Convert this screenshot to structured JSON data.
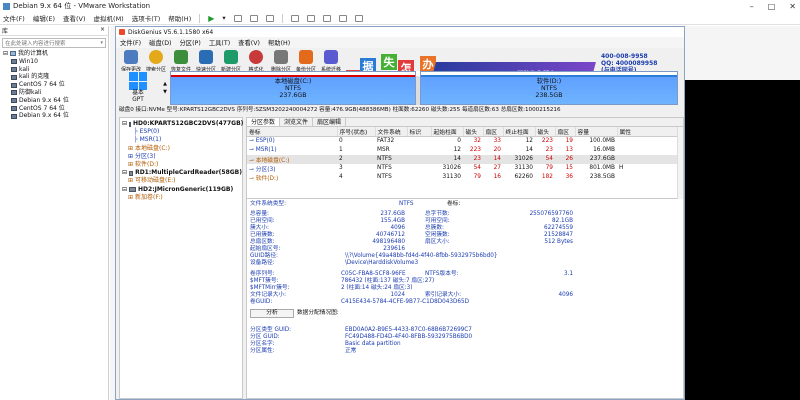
{
  "vmware": {
    "title": "Debian 9.x 64 位 - VMware Workstation",
    "menu": [
      "文件(F)",
      "编辑(E)",
      "查看(V)",
      "虚拟机(M)",
      "选项卡(T)",
      "帮助(H)"
    ]
  },
  "library": {
    "header": "库",
    "close": "×",
    "search_placeholder": "在此处键入内容进行搜索",
    "items": [
      {
        "label": "我的计算机",
        "level": 0
      },
      {
        "label": "Win10",
        "level": 1
      },
      {
        "label": "kali",
        "level": 1
      },
      {
        "label": "kali 的克隆",
        "level": 1
      },
      {
        "label": "CentOS 7 64 位",
        "level": 1
      },
      {
        "label": "防御kali",
        "level": 1
      },
      {
        "label": "Debian 9.x 64 位",
        "level": 1
      },
      {
        "label": "CentOS 7 64 位",
        "level": 1
      },
      {
        "label": "Debian 9.x 64 位",
        "level": 1
      }
    ]
  },
  "diskgenius": {
    "title": "DiskGenius V5.6.1.1580 x64",
    "menu": [
      "文件(F)",
      "磁盘(D)",
      "分区(P)",
      "工具(T)",
      "查看(V)",
      "帮助(H)"
    ],
    "toolbar": [
      {
        "label": "保存更改",
        "color": "#4c7bbf"
      },
      {
        "label": "搜索分区",
        "color": "#e3a91b"
      },
      {
        "label": "恢复文件",
        "color": "#3b8f3b"
      },
      {
        "label": "快速分区",
        "color": "#2a6db5"
      },
      {
        "label": "新建分区",
        "color": "#1f9a69"
      },
      {
        "label": "格式化",
        "color": "#c83a3a"
      },
      {
        "label": "删除分区",
        "color": "#777777"
      },
      {
        "label": "备份分区",
        "color": "#e36a1b"
      },
      {
        "label": "系统迁移",
        "color": "#5a5ad0"
      }
    ],
    "ad": {
      "chars": [
        "数",
        "据",
        "丢",
        "失",
        "怎",
        "么",
        "办"
      ],
      "banner": "DiskGenius 团队为您服务",
      "phone": "400-008-9958",
      "qq": "QQ: 4000089958",
      "note": "(与电话同号)"
    },
    "diskmap": {
      "label1": "基本",
      "label2": "GPT",
      "part_c": {
        "name": "本地磁盘(C:)",
        "fs": "NTFS",
        "size": "237.6GB"
      },
      "part_d": {
        "name": "软件(D:)",
        "fs": "NTFS",
        "size": "238.5GB"
      }
    },
    "disk_info": "磁盘0 接口:NVMe 型号:KPARTS12GBC2DVS 序列号:SZSM3202240004272 容量:476.9GB(488386MB) 柱面数:62260 磁头数:255 每道扇区数:63 总扇区数:1000215216",
    "tree": [
      {
        "label": "HD0:KPARTS12GBC2DVS(477GB)",
        "level": 0,
        "type": "disk"
      },
      {
        "label": "ESP(0)",
        "level": 1,
        "type": "part",
        "color": "blue"
      },
      {
        "label": "MSR(1)",
        "level": 1,
        "type": "part",
        "color": "blue"
      },
      {
        "label": "本地磁盘(C:)",
        "level": 1,
        "type": "part",
        "color": "orange"
      },
      {
        "label": "分区(3)",
        "level": 1,
        "type": "part",
        "color": "blue"
      },
      {
        "label": "软件(D:)",
        "level": 1,
        "type": "part",
        "color": "orange"
      },
      {
        "label": "RD1:MultipleCardReader(58GB)",
        "level": 0,
        "type": "disk"
      },
      {
        "label": "可移动磁盘(E:)",
        "level": 1,
        "type": "part",
        "color": "orange"
      },
      {
        "label": "HD2:JMicronGeneric(119GB)",
        "level": 0,
        "type": "disk"
      },
      {
        "label": "新加卷(F:)",
        "level": 1,
        "type": "part",
        "color": "orange"
      }
    ],
    "tabs": [
      "分区参数",
      "浏览文件",
      "扇区编辑"
    ],
    "table": {
      "headers": [
        "卷标",
        "序号(状态)",
        "文件系统",
        "标识",
        "起始柱面",
        "磁头",
        "扇区",
        "终止柱面",
        "磁头",
        "扇区",
        "容量",
        "属性"
      ],
      "rows": [
        [
          "ESP(0)",
          "0",
          "FAT32",
          "",
          "0",
          "32",
          "33",
          "12",
          "223",
          "19",
          "100.0MB",
          ""
        ],
        [
          "MSR(1)",
          "1",
          "MSR",
          "",
          "12",
          "223",
          "20",
          "14",
          "23",
          "13",
          "16.0MB",
          ""
        ],
        [
          "本地磁盘(C:)",
          "2",
          "NTFS",
          "",
          "14",
          "23",
          "14",
          "31026",
          "54",
          "26",
          "237.6GB",
          ""
        ],
        [
          "分区(3)",
          "3",
          "NTFS",
          "",
          "31026",
          "54",
          "27",
          "31130",
          "79",
          "15",
          "801.0MB",
          "H"
        ],
        [
          "软件(D:)",
          "4",
          "NTFS",
          "",
          "31130",
          "79",
          "16",
          "62260",
          "182",
          "36",
          "238.5GB",
          ""
        ]
      ]
    },
    "details": {
      "fs_type_label": "文件系统类型:",
      "fs_type_value": "NTFS",
      "vol_label": "卷标:",
      "left": [
        {
          "k": "总容量:",
          "v": "237.6GB",
          "k2": "总字节数:",
          "v2": "255076597760"
        },
        {
          "k": "已用空间:",
          "v": "155.4GB",
          "k2": "可用空间:",
          "v2": "82.1GB"
        },
        {
          "k": "簇大小:",
          "v": "4096",
          "k2": "总簇数:",
          "v2": "62274559"
        },
        {
          "k": "已用簇数:",
          "v": "40746712",
          "k2": "空闲簇数:",
          "v2": "21528847"
        },
        {
          "k": "总扇区数:",
          "v": "498196480",
          "k2": "扇区大小:",
          "v2": "512 Bytes"
        },
        {
          "k": "起始扇区号:",
          "v": "239616",
          "k2": "",
          "v2": ""
        }
      ],
      "guid_path_label": "GUID路径:",
      "guid_path_value": "\\\\?\\Volume{49a48bb-fd4d-4f40-8fbb-5932975b6bd0}",
      "device_path_label": "设备路径:",
      "device_path_value": "\\Device\\HarddiskVolume3",
      "serial_label": "卷序列号:",
      "serial_value": "C05C-FBA8-5CF8-96FE",
      "ntfs_ver_label": "NTFS版本号:",
      "ntfs_ver_value": "3.1",
      "mft_label": "$MFT簇号:",
      "mft_value": "786432 (柱面:137 磁头:7 扇区:27)",
      "mftmirr_label": "$MFTMirr簇号:",
      "mftmirr_value": "2 (柱面:14 磁头:24 扇区:3)",
      "frs_label": "文件记录大小:",
      "frs_value": "1024",
      "idx_label": "索引记录大小:",
      "idx_value": "4096",
      "volguid_label": "卷GUID:",
      "volguid_value": "C415E434-5784-4CFE-9B77-C1D8D043D65D",
      "analyze_button": "分析",
      "alloc_label": "数据分配情况图:",
      "type_guid_label": "分区类型 GUID:",
      "type_guid_value": "EBD0A0A2-B9E5-4433-87C0-68B6B72699C7",
      "part_guid_label": "分区 GUID:",
      "part_guid_value": "FC49D488-FD4D-4F40-8FBB-5932975B6BD0",
      "part_name_label": "分区名字:",
      "part_name_value": "Basic data partition",
      "part_attr_label": "分区属性:",
      "part_attr_value": "正常"
    }
  }
}
